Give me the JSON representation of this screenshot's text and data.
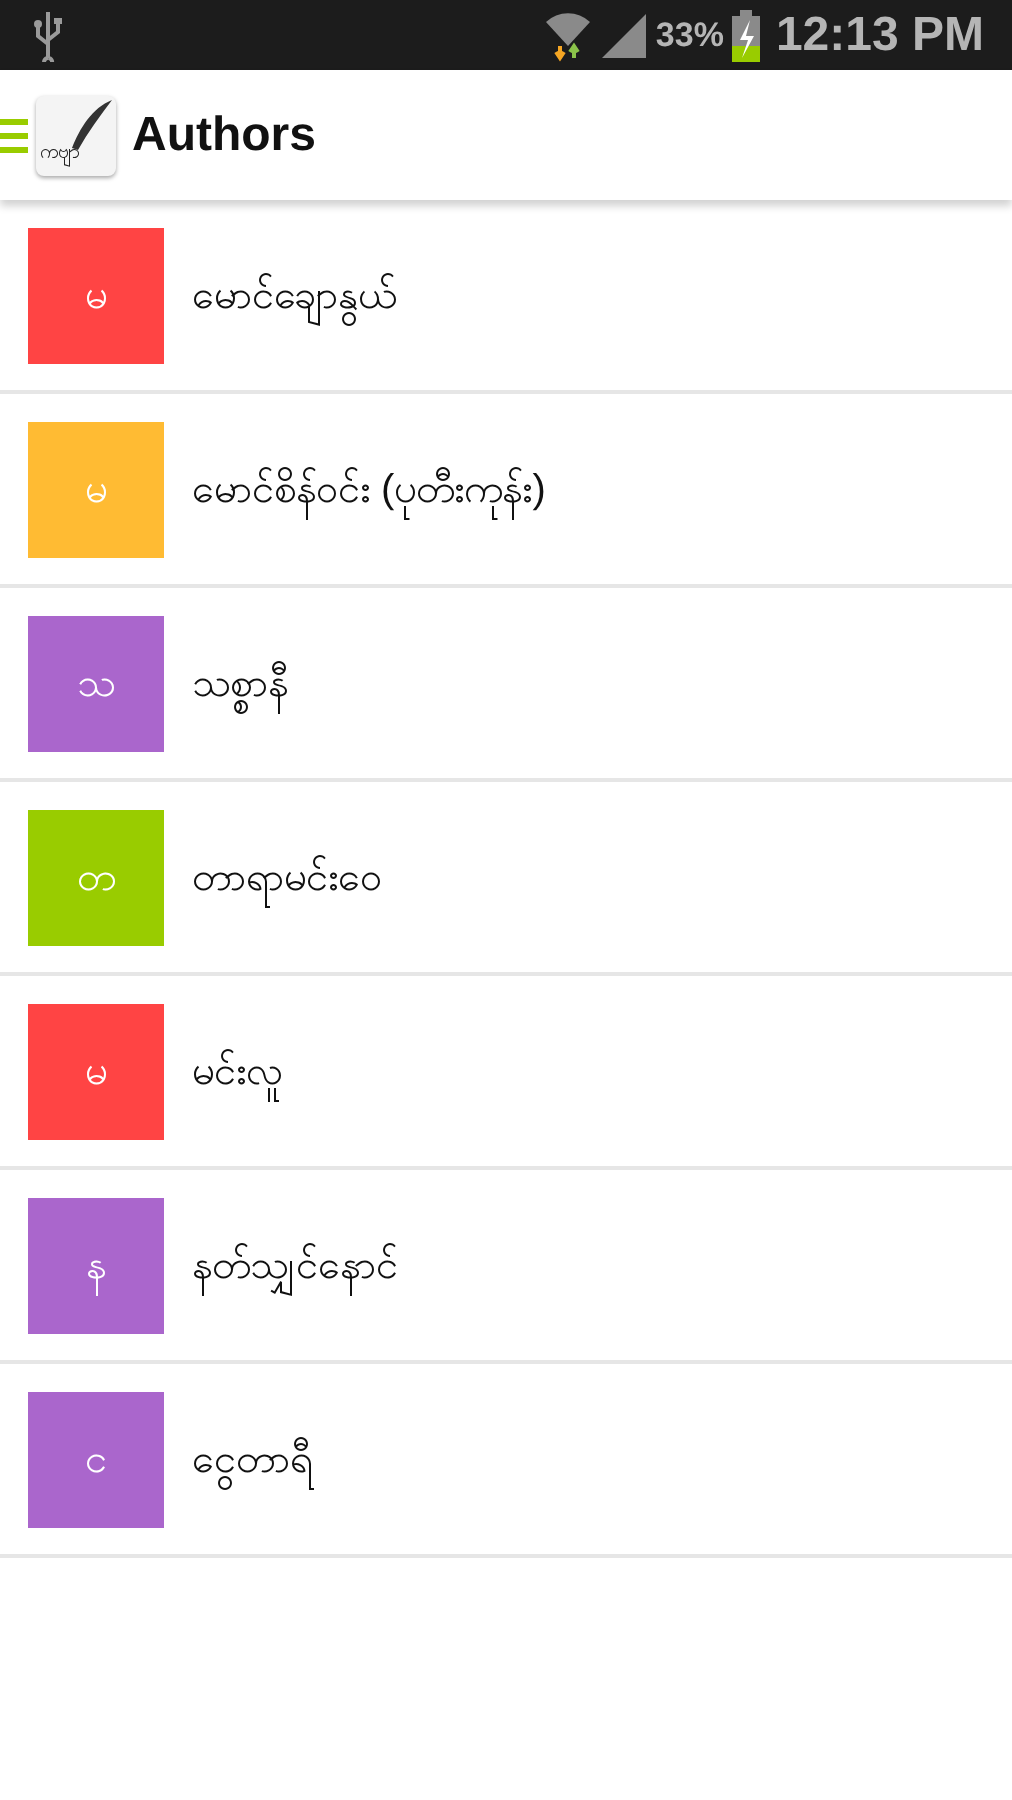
{
  "status_bar": {
    "battery": "33%",
    "time": "12:13 PM"
  },
  "action_bar": {
    "app_icon_text": "ကဗျာ",
    "title": "Authors"
  },
  "authors": [
    {
      "initial": "မ",
      "name": "မောင်ချောနွယ်",
      "color": "#ff4444"
    },
    {
      "initial": "မ",
      "name": "မောင်စိန်ဝင်း (ပုတီးကုန်း)",
      "color": "#ffbb33"
    },
    {
      "initial": "သ",
      "name": "သစ္စာနီ",
      "color": "#aa66cc"
    },
    {
      "initial": "တ",
      "name": "တာရာမင်းဝေ",
      "color": "#99cc00"
    },
    {
      "initial": "မ",
      "name": "မင်းလူ",
      "color": "#ff4444"
    },
    {
      "initial": "န",
      "name": "နတ်သျှင်နောင်",
      "color": "#aa66cc"
    },
    {
      "initial": "င",
      "name": "ငွေတာရီ",
      "color": "#aa66cc"
    }
  ]
}
